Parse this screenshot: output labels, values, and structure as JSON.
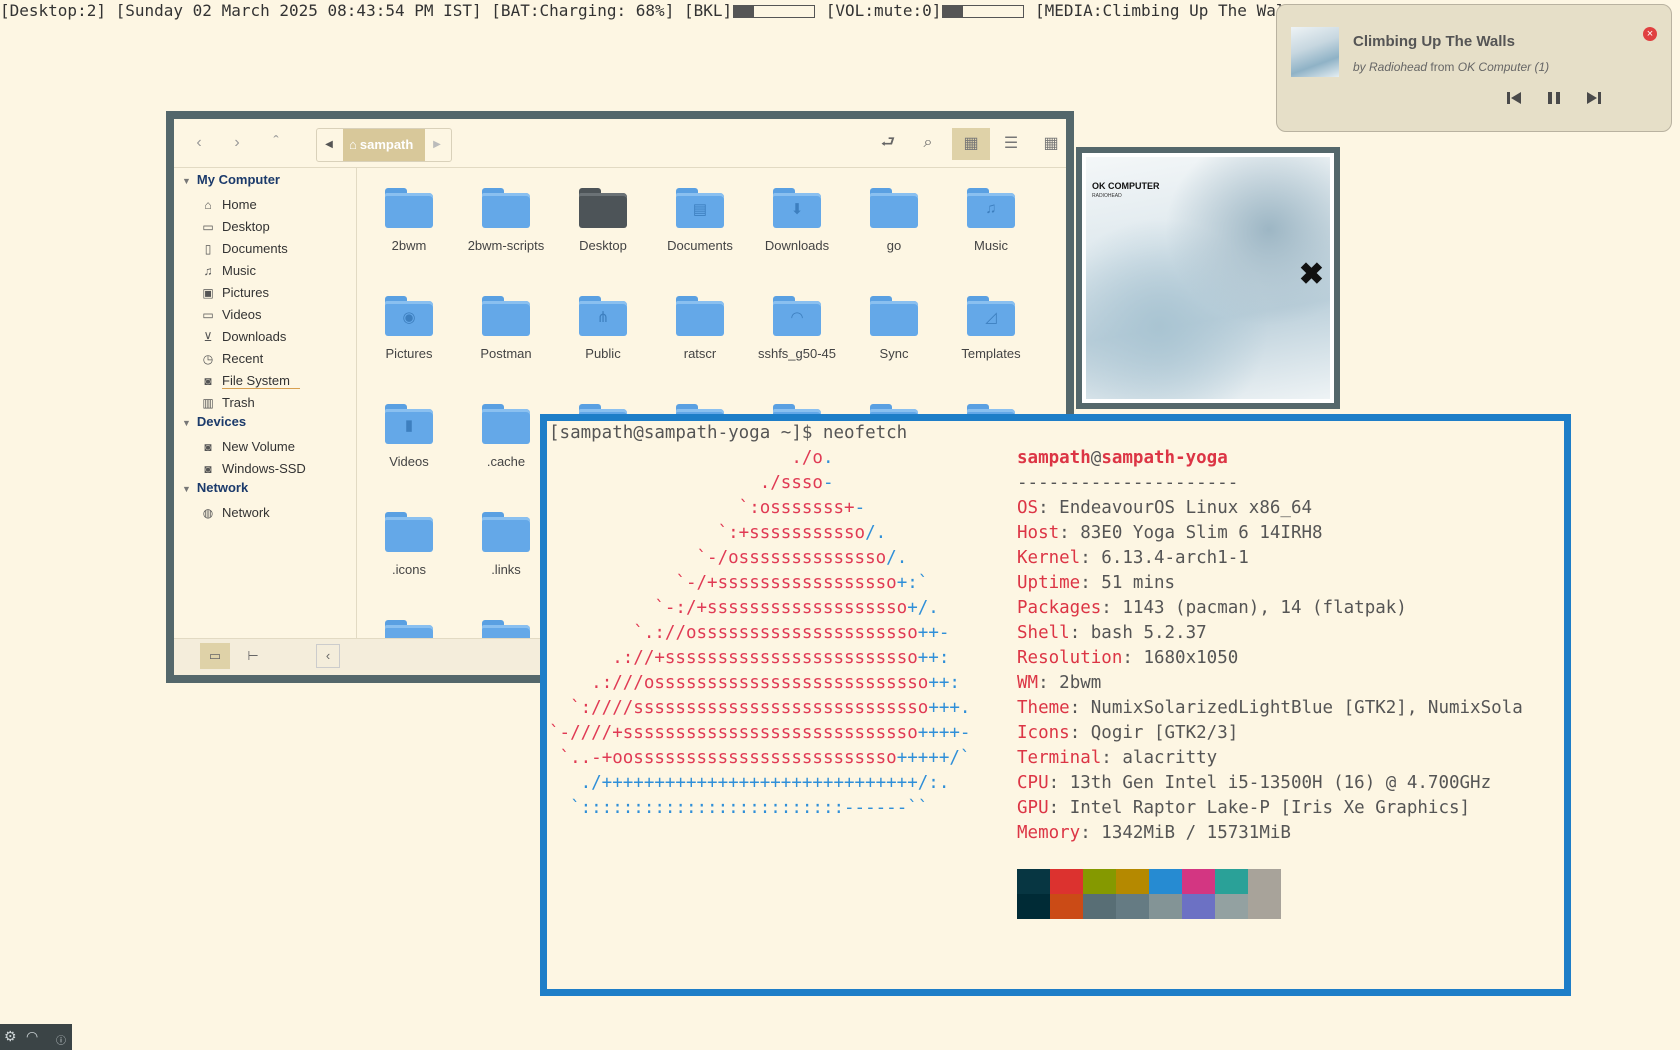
{
  "statusbar": {
    "desktop": "[Desktop:2]",
    "datetime": "[Sunday 02 March 2025 08:43:54 PM IST]",
    "battery": "[BAT:Charging: 68%]",
    "backlight_label": "[BKL]",
    "backlight_level": 0.25,
    "volume_label": "[VOL:mute:0]",
    "volume_level": 0.25,
    "media": "[MEDIA:Climbing Up The Walls"
  },
  "notification": {
    "title": "Climbing Up The Walls",
    "by_prefix": "by ",
    "artist": "Radiohead",
    "from_prefix": " from ",
    "album": "OK Computer (1)",
    "close_icon": "close-icon",
    "controls": [
      "previous-icon",
      "pause-icon",
      "next-icon"
    ],
    "close_color": "#e04040"
  },
  "file_manager": {
    "path_segment": "sampath",
    "toolbar_icons": [
      "back-icon",
      "forward-icon",
      "up-icon",
      "toggle-location-icon",
      "search-icon",
      "icon-view-icon",
      "list-view-icon",
      "compact-view-icon"
    ],
    "sidebar": {
      "my_computer": "My Computer",
      "my_computer_items": [
        {
          "label": "Home",
          "icon": "home-icon"
        },
        {
          "label": "Desktop",
          "icon": "desktop-icon"
        },
        {
          "label": "Documents",
          "icon": "documents-icon"
        },
        {
          "label": "Music",
          "icon": "music-icon"
        },
        {
          "label": "Pictures",
          "icon": "pictures-icon"
        },
        {
          "label": "Videos",
          "icon": "videos-icon"
        },
        {
          "label": "Downloads",
          "icon": "downloads-icon"
        },
        {
          "label": "Recent",
          "icon": "recent-icon"
        },
        {
          "label": "File System",
          "icon": "drive-icon"
        },
        {
          "label": "Trash",
          "icon": "trash-icon"
        }
      ],
      "devices": "Devices",
      "device_items": [
        {
          "label": "New Volume",
          "icon": "drive-icon"
        },
        {
          "label": "Windows-SSD",
          "icon": "drive-icon"
        }
      ],
      "network": "Network",
      "network_items": [
        {
          "label": "Network",
          "icon": "network-icon"
        }
      ]
    },
    "items": [
      "2bwm",
      "2bwm-scripts",
      "Desktop",
      "Documents",
      "Downloads",
      "go",
      "Music",
      "Pictures",
      "Postman",
      "Public",
      "ratscr",
      "sshfs_g50-45",
      "Sync",
      "Templates",
      "Videos",
      ".cache",
      ".icons",
      ".links"
    ],
    "folder_color": "#64a8e8"
  },
  "album_art": {
    "title": "OK COMPUTER",
    "artist": "RADIOHEAD"
  },
  "terminal": {
    "prompt": "[sampath@sampath-yoga ~]$ neofetch",
    "user": "sampath",
    "at": "@",
    "host": "sampath-yoga",
    "separator": "---------------------",
    "info": [
      {
        "key": "OS",
        "value": "EndeavourOS Linux x86_64"
      },
      {
        "key": "Host",
        "value": "83E0 Yoga Slim 6 14IRH8"
      },
      {
        "key": "Kernel",
        "value": "6.13.4-arch1-1"
      },
      {
        "key": "Uptime",
        "value": "51 mins"
      },
      {
        "key": "Packages",
        "value": "1143 (pacman), 14 (flatpak)"
      },
      {
        "key": "Shell",
        "value": "bash 5.2.37"
      },
      {
        "key": "Resolution",
        "value": "1680x1050"
      },
      {
        "key": "WM",
        "value": "2bwm"
      },
      {
        "key": "Theme",
        "value": "NumixSolarizedLightBlue [GTK2], NumixSola"
      },
      {
        "key": "Icons",
        "value": "Qogir [GTK2/3]"
      },
      {
        "key": "Terminal",
        "value": "alacritty"
      },
      {
        "key": "CPU",
        "value": "13th Gen Intel i5-13500H (16) @ 4.700GHz"
      },
      {
        "key": "GPU",
        "value": "Intel Raptor Lake-P [Iris Xe Graphics]"
      },
      {
        "key": "Memory",
        "value": "1342MiB / 15731MiB"
      }
    ],
    "logo_lines": [
      {
        "indent": 23,
        "red": "./o",
        "blue": "."
      },
      {
        "indent": 20,
        "red": "./ssso",
        "blue": "-"
      },
      {
        "indent": 18,
        "red": "`:osssssss+",
        "blue": "-"
      },
      {
        "indent": 16,
        "red": "`:+sssssssssso",
        "blue": "/."
      },
      {
        "indent": 14,
        "red": "`-/ossssssssssssso",
        "blue": "/."
      },
      {
        "indent": 12,
        "red": "`-/+sssssssssssssssso",
        "blue": "+:`"
      },
      {
        "indent": 10,
        "red": "`-:/+sssssssssssssssssso",
        "blue": "+/."
      },
      {
        "indent": 8,
        "red": "`.://osssssssssssssssssssso",
        "blue": "++-"
      },
      {
        "indent": 6,
        "red": ".://+ssssssssssssssssssssssso",
        "blue": "++:"
      },
      {
        "indent": 4,
        "red": ".:///ossssssssssssssssssssssssso",
        "blue": "++:"
      },
      {
        "indent": 2,
        "red": "`:////ssssssssssssssssssssssssssso",
        "blue": "+++."
      },
      {
        "indent": 0,
        "red": "`-////+ssssssssssssssssssssssssssso",
        "blue": "++++-"
      },
      {
        "indent": 1,
        "red": "`..-+oosssssssssssssssssssssssso",
        "blue": "+++++/`"
      },
      {
        "indent": 3,
        "red": "",
        "blue": "./++++++++++++++++++++++++++++++/:."
      },
      {
        "indent": 2,
        "red": "",
        "blue": "`:::::::::::::::::::::::::------``"
      }
    ],
    "palette_top": [
      "#073642",
      "#dc322f",
      "#859900",
      "#b58900",
      "#268bd2",
      "#d33682",
      "#2aa198",
      "#a8a39a"
    ],
    "palette_bottom": [
      "#002b36",
      "#cb4b16",
      "#586e75",
      "#657b83",
      "#839496",
      "#6c71c4",
      "#93a1a1",
      "#a8a39a"
    ]
  },
  "tray": {
    "icons": [
      "settings-icon",
      "wifi-icon",
      "info-icon"
    ]
  }
}
